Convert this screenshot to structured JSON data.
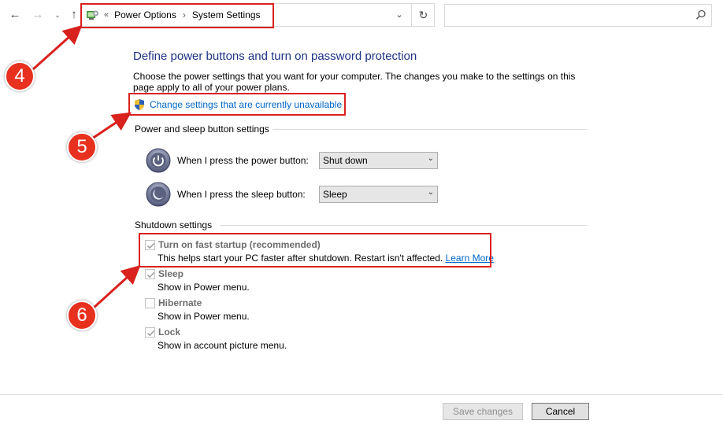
{
  "nav": {
    "back_glyph": "←",
    "forward_glyph": "→",
    "recent_glyph": "⌄",
    "up_glyph": "↑"
  },
  "address_bar": {
    "overflow_glyph": "«",
    "crumbs": [
      "Power Options",
      "System Settings"
    ],
    "separator": "›",
    "dropdown_glyph": "⌄",
    "refresh_glyph": "↻"
  },
  "search": {
    "placeholder": ""
  },
  "annotations": [
    "4",
    "5",
    "6"
  ],
  "main": {
    "title": "Define power buttons and turn on password protection",
    "description": "Choose the power settings that you want for your computer. The changes you make to the settings on this page apply to all of your power plans.",
    "change_link": "Change settings that are currently unavailable"
  },
  "power_group": {
    "title": "Power and sleep button settings",
    "rows": [
      {
        "label": "When I press the power button:",
        "value": "Shut down"
      },
      {
        "label": "When I press the sleep button:",
        "value": "Sleep"
      }
    ]
  },
  "shutdown_group": {
    "title": "Shutdown settings",
    "items": [
      {
        "label": "Turn on fast startup (recommended)",
        "description": "This helps start your PC faster after shutdown. Restart isn't affected.",
        "link": "Learn More",
        "checked": true
      },
      {
        "label": "Sleep",
        "description": "Show in Power menu.",
        "checked": true
      },
      {
        "label": "Hibernate",
        "description": "Show in Power menu.",
        "checked": false
      },
      {
        "label": "Lock",
        "description": "Show in account picture menu.",
        "checked": true
      }
    ]
  },
  "footer": {
    "save_label": "Save changes",
    "cancel_label": "Cancel"
  },
  "colors": {
    "annotation_red": "#d9211e",
    "title_blue": "#1e3287",
    "link_blue": "#0066cc"
  }
}
